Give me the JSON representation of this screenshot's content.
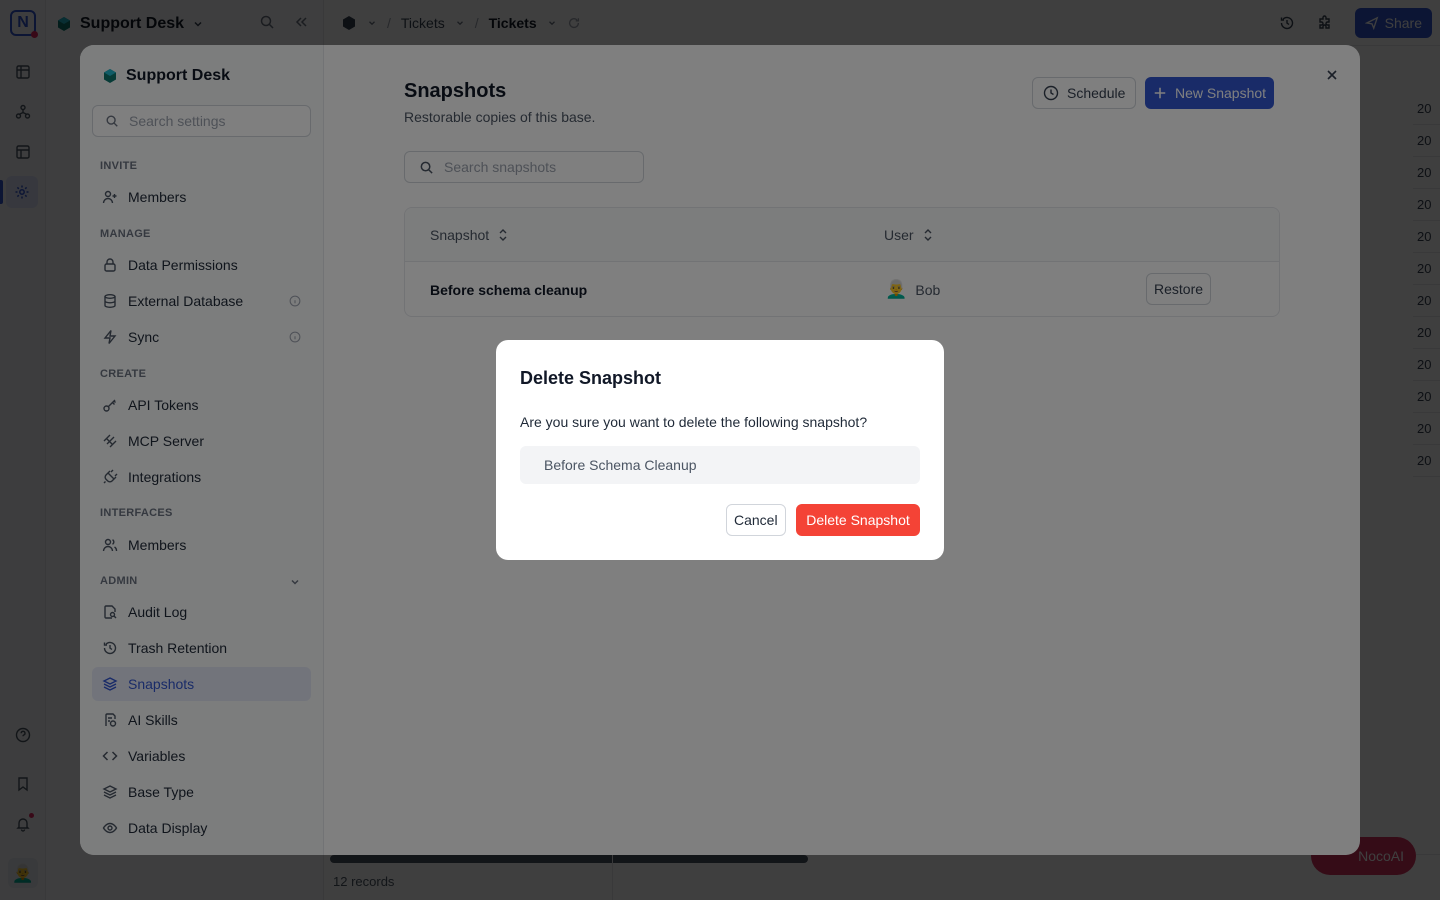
{
  "app": {
    "workspace_title": "Support Desk",
    "breadcrumb": [
      "Tickets",
      "Tickets"
    ],
    "share_label": "Share",
    "records_count": "12 records",
    "nocoai_label": "NocoAI",
    "grid_cell_value": "20",
    "accent_color": "#3357d1"
  },
  "settings": {
    "base_name": "Support Desk",
    "search_placeholder": "Search settings",
    "groups": {
      "invite": "INVITE",
      "manage": "MANAGE",
      "create": "CREATE",
      "interfaces": "INTERFACES",
      "admin": "ADMIN"
    },
    "nav": {
      "members_invite": "Members",
      "data_permissions": "Data Permissions",
      "external_database": "External Database",
      "sync": "Sync",
      "api_tokens": "API Tokens",
      "mcp_server": "MCP Server",
      "integrations": "Integrations",
      "members_interfaces": "Members",
      "audit_log": "Audit Log",
      "trash_retention": "Trash Retention",
      "snapshots": "Snapshots",
      "ai_skills": "AI Skills",
      "variables": "Variables",
      "base_type": "Base Type",
      "data_display": "Data Display"
    }
  },
  "snapshots": {
    "title": "Snapshots",
    "subtitle": "Restorable copies of this base.",
    "schedule_label": "Schedule",
    "new_label": "New Snapshot",
    "search_placeholder": "Search snapshots",
    "columns": {
      "snapshot": "Snapshot",
      "user": "User"
    },
    "rows": [
      {
        "name": "Before schema cleanup",
        "user": "Bob",
        "action": "Restore"
      }
    ]
  },
  "dialog": {
    "title": "Delete Snapshot",
    "message": "Are you sure you want to delete the following snapshot?",
    "snapshot_name": "Before Schema Cleanup",
    "cancel_label": "Cancel",
    "delete_label": "Delete Snapshot",
    "danger_color": "#f44336"
  }
}
